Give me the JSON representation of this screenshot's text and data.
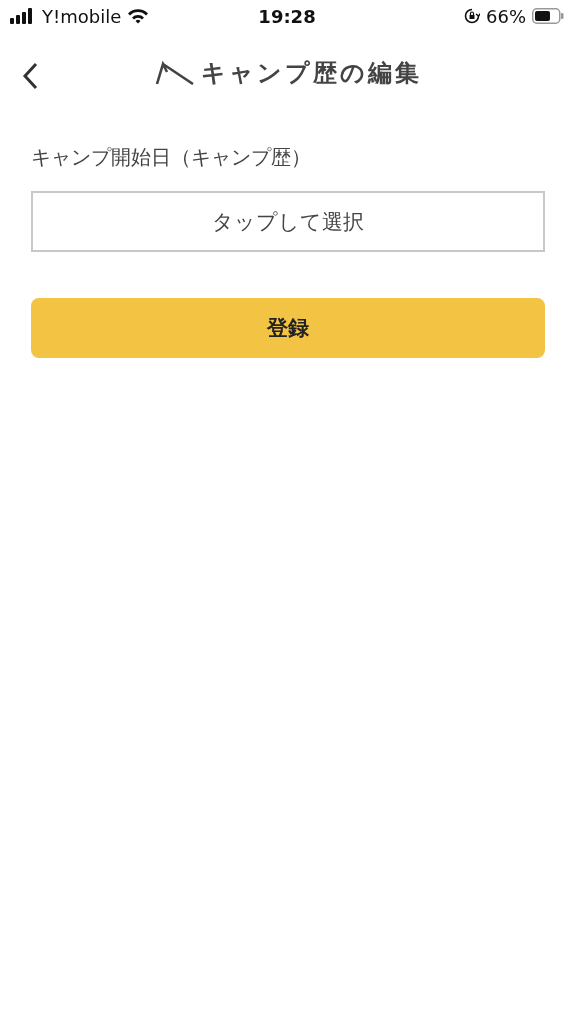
{
  "status_bar": {
    "carrier": "Y!mobile",
    "time": "19:28",
    "battery": "66%"
  },
  "header": {
    "title": "キャンプ歴の編集"
  },
  "form": {
    "label": "キャンプ開始日（キャンプ歴）",
    "date_field": {
      "placeholder": "タップして選択"
    },
    "submit": "登録"
  }
}
